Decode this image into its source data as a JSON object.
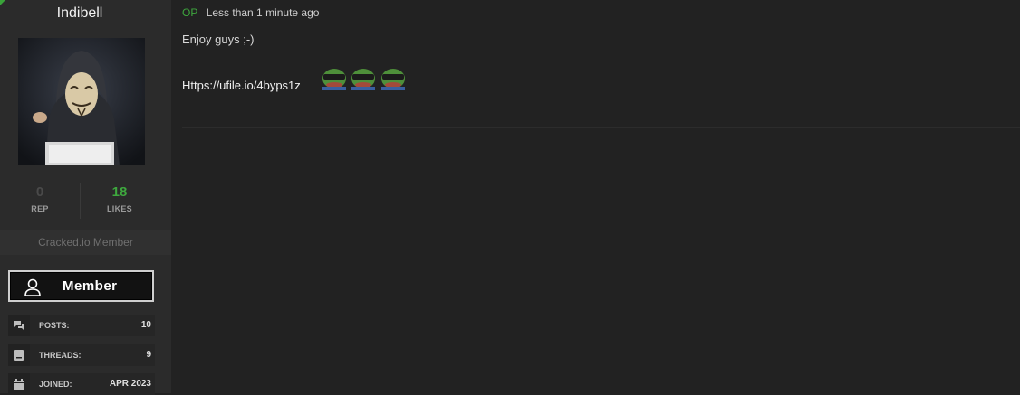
{
  "user": {
    "name": "Indibell",
    "avatar": "anonymous-hacker-avatar",
    "rep": {
      "value": "0",
      "label": "REP"
    },
    "likes": {
      "value": "18",
      "label": "LIKES"
    },
    "title": "Cracked.io Member",
    "badge": "Member",
    "info": [
      {
        "icon": "comments-icon",
        "label": "POSTS:",
        "value": "10"
      },
      {
        "icon": "threads-icon",
        "label": "THREADS:",
        "value": "9"
      },
      {
        "icon": "calendar-icon",
        "label": "JOINED:",
        "value": "APR 2023"
      }
    ]
  },
  "post": {
    "op_tag": "OP",
    "time": "Less than 1 minute ago",
    "line1": "Enjoy guys ;-)",
    "link": "Https://ufile.io/4byps1z",
    "emojis": [
      "pepe-frog-emoji",
      "pepe-frog-emoji",
      "pepe-frog-emoji"
    ]
  },
  "colors": {
    "accent_green": "#3ea83e",
    "background": "#222222",
    "sidebar": "#2b2b2b"
  }
}
